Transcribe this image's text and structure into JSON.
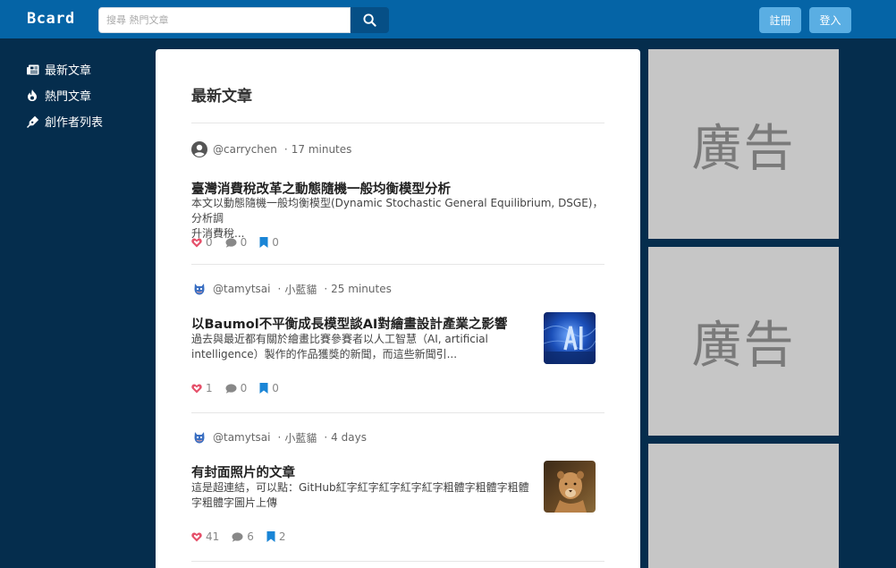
{
  "header": {
    "logo": "Bcard",
    "search_placeholder": "搜尋 熱門文章",
    "register_label": "註冊",
    "login_label": "登入"
  },
  "sidebar": {
    "items": [
      {
        "label": "最新文章",
        "icon": "newspaper-icon"
      },
      {
        "label": "熱門文章",
        "icon": "fire-icon"
      },
      {
        "label": "創作者列表",
        "icon": "pen-icon"
      }
    ]
  },
  "main": {
    "title": "最新文章",
    "articles": [
      {
        "author": "@carrychen",
        "board": "",
        "time": "17 minutes",
        "title": "臺灣消費稅改革之動態隨機一般均衡模型分析",
        "desc1": "本文以動態隨機一般均衡模型(Dynamic Stochastic General Equilibrium, DSGE)，分析調",
        "desc2": "升消費稅...",
        "likes": "0",
        "comments": "0",
        "bookmarks": "0"
      },
      {
        "author": "@tamytsai",
        "board": "小藍貓",
        "time": "25 minutes",
        "title": "以Baumol不平衡成長模型談AI對繪畫設計產業之影響",
        "desc1": "過去與最近都有關於繪畫比賽參賽者以人工智慧（AI, artificial",
        "desc2": "intelligence）製作的作品獲獎的新聞，而這些新聞引...",
        "likes": "1",
        "comments": "0",
        "bookmarks": "0"
      },
      {
        "author": "@tamytsai",
        "board": "小藍貓",
        "time": "4 days",
        "title": "有封面照片的文章",
        "desc1": "這是超連結，可以點：GitHub紅字紅字紅字紅字紅字粗體字粗體字粗體",
        "desc2": "字粗體字圖片上傳",
        "likes": "41",
        "comments": "6",
        "bookmarks": "2"
      }
    ]
  },
  "ads": [
    {
      "label": "廣告"
    },
    {
      "label": "廣告"
    },
    {
      "label": ""
    }
  ],
  "colors": {
    "background": "#052d4d",
    "topbar": "#0564a6",
    "button": "#5aaee3",
    "heart": "#e5506a",
    "bookmark": "#1a85d6"
  }
}
